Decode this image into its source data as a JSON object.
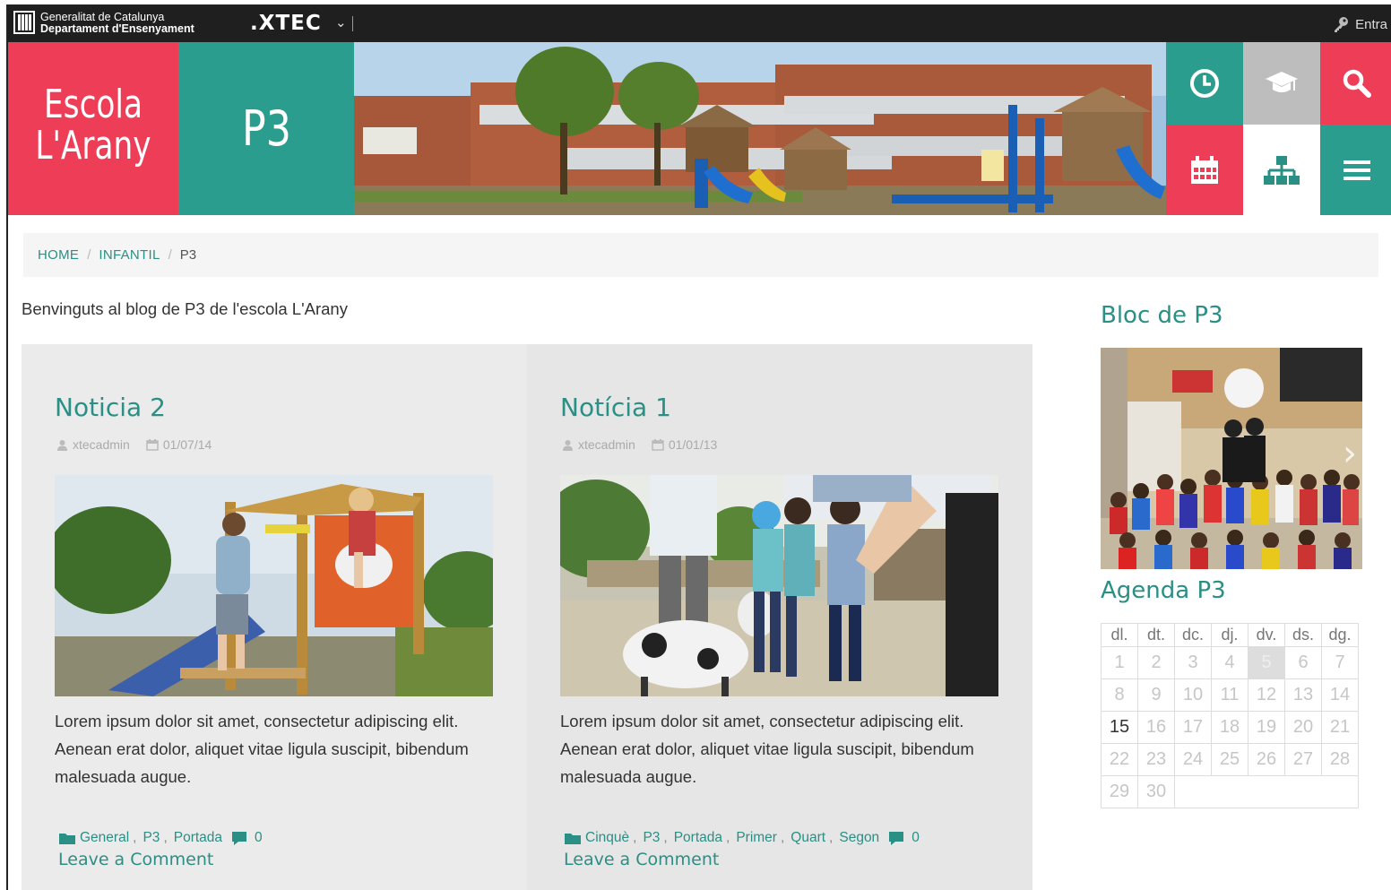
{
  "topbar": {
    "org_line1": "Generalitat de Catalunya",
    "org_line2": "Departament d'Ensenyament",
    "portal": ".XTEC",
    "login_label": "Entra"
  },
  "header": {
    "school_line1": "Escola",
    "school_line2": "L'Arany",
    "section": "P3",
    "icons": [
      "clock-icon",
      "graduation-cap-icon",
      "search-icon",
      "calendar-icon",
      "sitemap-icon",
      "menu-icon"
    ],
    "colors": {
      "red": "#ee3d57",
      "teal": "#2a9d8f",
      "grey": "#bdbdbd"
    }
  },
  "breadcrumb": {
    "home": "HOME",
    "parent": "INFANTIL",
    "current": "P3"
  },
  "welcome": "Benvinguts al blog de P3 de l'escola L'Arany",
  "posts": [
    {
      "title": "Noticia 2",
      "author": "xtecadmin",
      "date": "01/07/14",
      "excerpt": "Lorem ipsum dolor sit amet, consectetur adipiscing elit. Aenean erat dolor, aliquet vitae ligula suscipit, bibendum malesuada augue.",
      "categories": [
        "General",
        "P3",
        "Portada"
      ],
      "comments": "0",
      "comment_link": "Leave a Comment"
    },
    {
      "title": "Notícia 1",
      "author": "xtecadmin",
      "date": "01/01/13",
      "excerpt": "Lorem ipsum dolor sit amet, consectetur adipiscing elit. Aenean erat dolor, aliquet vitae ligula suscipit, bibendum malesuada augue.",
      "categories": [
        "Cinquè",
        "P3",
        "Portada",
        "Primer",
        "Quart",
        "Segon"
      ],
      "comments": "0",
      "comment_link": "Leave a Comment"
    }
  ],
  "sidebar": {
    "blog_title": "Bloc de P3",
    "agenda_title": "Agenda P3",
    "calendar": {
      "days": [
        "dl.",
        "dt.",
        "dc.",
        "dj.",
        "dv.",
        "ds.",
        "dg."
      ],
      "weeks": [
        [
          "1",
          "2",
          "3",
          "4",
          "5",
          "6",
          "7"
        ],
        [
          "8",
          "9",
          "10",
          "11",
          "12",
          "13",
          "14"
        ],
        [
          "15",
          "16",
          "17",
          "18",
          "19",
          "20",
          "21"
        ],
        [
          "22",
          "23",
          "24",
          "25",
          "26",
          "27",
          "28"
        ],
        [
          "29",
          "30"
        ]
      ],
      "today": "15",
      "highlighted": "5"
    }
  }
}
